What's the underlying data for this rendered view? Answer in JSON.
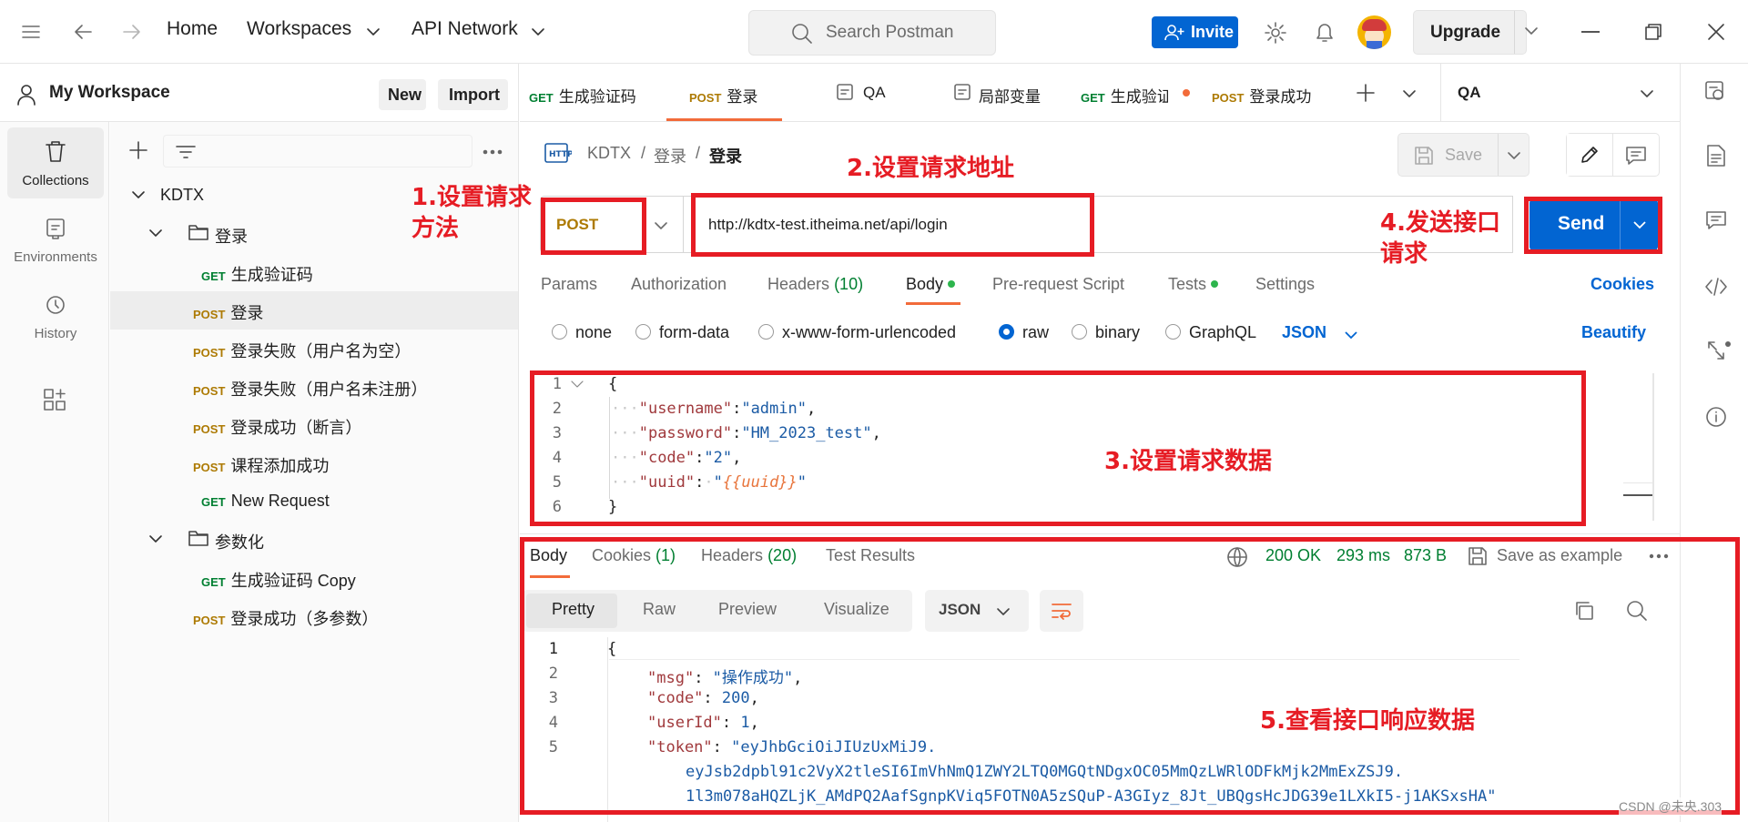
{
  "nav": {
    "home": "Home",
    "workspaces": "Workspaces",
    "api_network": "API Network",
    "search_placeholder": "Search Postman",
    "invite": "Invite",
    "upgrade": "Upgrade"
  },
  "workspace": {
    "title": "My Workspace",
    "new": "New",
    "import": "Import"
  },
  "rail": [
    {
      "label": "Collections"
    },
    {
      "label": "Environments"
    },
    {
      "label": "History"
    }
  ],
  "tree": {
    "collection": "KDTX",
    "folder1": "登录",
    "items1": [
      {
        "method": "GET",
        "name": "生成验证码"
      },
      {
        "method": "POST",
        "name": "登录"
      },
      {
        "method": "POST",
        "name": "登录失败（用户名为空）"
      },
      {
        "method": "POST",
        "name": "登录失败（用户名未注册）"
      },
      {
        "method": "POST",
        "name": "登录成功（断言）"
      },
      {
        "method": "POST",
        "name": "课程添加成功"
      },
      {
        "method": "GET",
        "name": "New Request"
      }
    ],
    "folder2": "参数化",
    "items2": [
      {
        "method": "GET",
        "name": "生成验证码 Copy"
      },
      {
        "method": "POST",
        "name": "登录成功（多参数）"
      }
    ]
  },
  "tabs": [
    {
      "method": "GET",
      "name": "生成验证码"
    },
    {
      "method": "POST",
      "name": "登录"
    },
    {
      "method": "",
      "name": "QA"
    },
    {
      "method": "",
      "name": "局部变量"
    },
    {
      "method": "GET",
      "name": "生成验证码"
    },
    {
      "method": "POST",
      "name": "登录成功"
    }
  ],
  "environment": "QA",
  "request": {
    "breadcrumb": [
      "KDTX",
      "登录",
      "登录"
    ],
    "save": "Save",
    "method": "POST",
    "url": "http://kdtx-test.itheima.net/api/login",
    "send": "Send",
    "tabs": [
      "Params",
      "Authorization",
      "Headers",
      "(10)",
      "Body",
      "Pre-request Script",
      "Tests",
      "Settings"
    ],
    "cookies": "Cookies",
    "body_types": [
      "none",
      "form-data",
      "x-www-form-urlencoded",
      "raw",
      "binary",
      "GraphQL"
    ],
    "body_format": "JSON",
    "beautify": "Beautify",
    "body_lines": [
      {
        "n": "1",
        "t": "{"
      },
      {
        "n": "2",
        "k": "\"username\"",
        "v": "\"admin\""
      },
      {
        "n": "3",
        "k": "\"password\"",
        "v": "\"HM_2023_test\""
      },
      {
        "n": "4",
        "k": "\"code\"",
        "v": "\"2\""
      },
      {
        "n": "5",
        "k": "\"uuid\"",
        "v": "{{uuid}}"
      },
      {
        "n": "6",
        "t": "}"
      }
    ]
  },
  "response": {
    "tabs": [
      "Body",
      "Cookies",
      "(1)",
      "Headers",
      "(20)",
      "Test Results"
    ],
    "status": "200 OK",
    "time": "293 ms",
    "size": "873 B",
    "save_example": "Save as example",
    "views": [
      "Pretty",
      "Raw",
      "Preview",
      "Visualize"
    ],
    "format": "JSON",
    "lines": [
      {
        "n": "1",
        "t": "{"
      },
      {
        "n": "2",
        "k": "\"msg\"",
        "v": "\"操作成功\""
      },
      {
        "n": "3",
        "k": "\"code\"",
        "v": "200"
      },
      {
        "n": "4",
        "k": "\"userId\"",
        "v": "1"
      },
      {
        "n": "5",
        "k": "\"token\"",
        "v": "\"eyJhbGciOiJIUzUxMiJ9."
      },
      {
        "n": "",
        "c": "eyJsb2dpbl91c2VyX2tleSI6ImVhNmQ1ZWY2LTQ0MGQtNDgxOC05MmQzLWRlODFkMjk2MmExZSJ9."
      },
      {
        "n": "",
        "c": "1l3m078aHQZLjK_AMdPQ2AafSgnpKViq5FOTN0A5zSQuP-A3GIyz_8Jt_UBQgsHcJDG39e1LXkI5-j1AKSxsHA\""
      }
    ]
  },
  "annotations": {
    "a1": "1.设置请求\n方法",
    "a2": "2.设置请求地址",
    "a3": "3.设置请求数据",
    "a4": "4.发送接口\n请求",
    "a5": "5.查看接口响应数据"
  },
  "watermark": "CSDN @未央.303"
}
